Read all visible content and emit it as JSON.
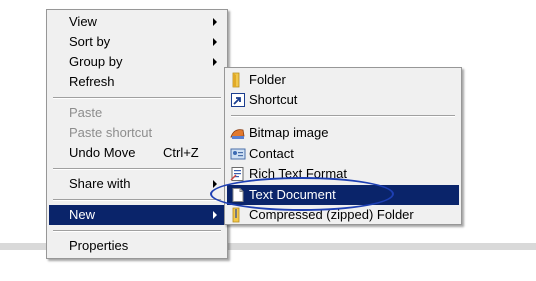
{
  "context_menu": {
    "view": "View",
    "sort_by": "Sort by",
    "group_by": "Group by",
    "refresh": "Refresh",
    "paste": "Paste",
    "paste_shortcut": "Paste shortcut",
    "undo_move": "Undo Move",
    "undo_move_shortcut": "Ctrl+Z",
    "share_with": "Share with",
    "new": "New",
    "properties": "Properties"
  },
  "new_submenu": {
    "items": [
      {
        "label": "Folder",
        "icon": "folder-icon"
      },
      {
        "label": "Shortcut",
        "icon": "shortcut-icon"
      },
      {
        "label": "Bitmap image",
        "icon": "bitmap-icon"
      },
      {
        "label": "Contact",
        "icon": "contact-icon"
      },
      {
        "label": "Rich Text Format",
        "icon": "rich-text-icon"
      },
      {
        "label": "Text Document",
        "icon": "text-document-icon"
      },
      {
        "label": "Compressed (zipped) Folder",
        "icon": "zip-folder-icon"
      }
    ]
  },
  "colors": {
    "highlight": "#0a246a",
    "annotation_ellipse": "#1d3fb3"
  }
}
